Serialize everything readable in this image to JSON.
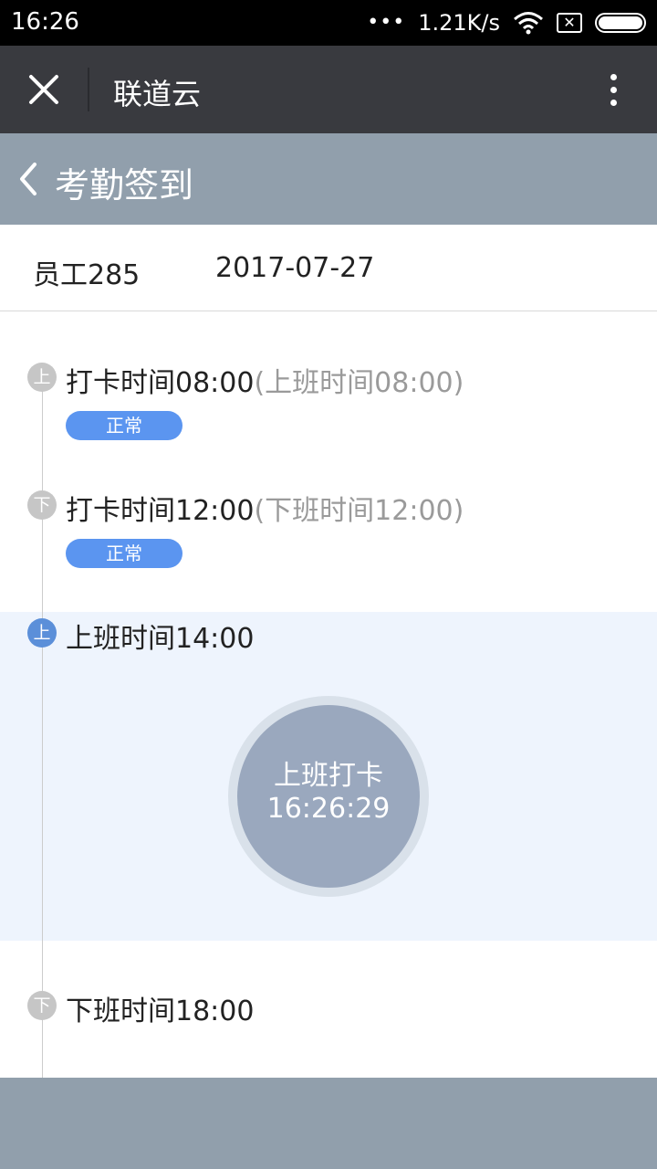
{
  "status_bar": {
    "time": "16:26",
    "dots": "•••",
    "network_speed": "1.21K/s",
    "icons": [
      "wifi-icon",
      "sim-error-icon",
      "battery-icon"
    ]
  },
  "app_bar": {
    "title": "联道云",
    "icons": [
      "close-icon",
      "more-vertical-icon"
    ]
  },
  "page_header": {
    "title": "考勤签到",
    "icon": "chevron-left-icon"
  },
  "info": {
    "employee": "员工285",
    "date": "2017-07-27"
  },
  "timeline": [
    {
      "icon_label": "上",
      "main": "打卡时间08:00",
      "sub": "(上班时间08:00)",
      "badge": "正常"
    },
    {
      "icon_label": "下",
      "main": "打卡时间12:00",
      "sub": "(下班时间12:00)",
      "badge": "正常"
    },
    {
      "icon_label": "上",
      "main": "上班时间14:00"
    },
    {
      "icon_label": "下",
      "main": "下班时间18:00"
    }
  ],
  "punch": {
    "label": "上班打卡",
    "time": "16:26:29"
  },
  "colors": {
    "status_bar": "#000000",
    "app_bar": "#393a3f",
    "header": "#919fac",
    "badge": "#5b95f0",
    "active_icon": "#5b8fd9",
    "highlight": "#eef4fd",
    "punch_button": "#9aa8be"
  }
}
